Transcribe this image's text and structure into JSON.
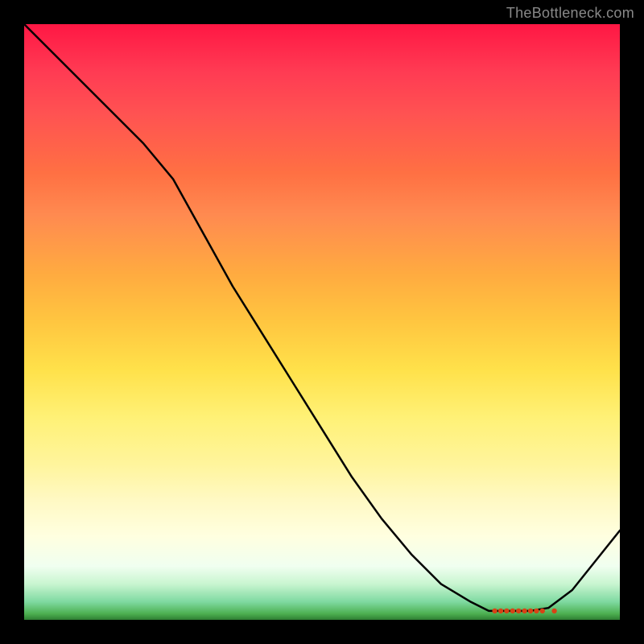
{
  "watermark": "TheBottleneck.com",
  "chart_data": {
    "type": "line",
    "title": "",
    "xlabel": "",
    "ylabel": "",
    "x": [
      0.0,
      0.05,
      0.1,
      0.15,
      0.2,
      0.25,
      0.3,
      0.35,
      0.4,
      0.45,
      0.5,
      0.55,
      0.6,
      0.65,
      0.7,
      0.75,
      0.78,
      0.8,
      0.82,
      0.85,
      0.88,
      0.92,
      0.96,
      1.0
    ],
    "y": [
      1.0,
      0.95,
      0.9,
      0.85,
      0.8,
      0.74,
      0.65,
      0.56,
      0.48,
      0.4,
      0.32,
      0.24,
      0.17,
      0.11,
      0.06,
      0.03,
      0.015,
      0.015,
      0.015,
      0.015,
      0.02,
      0.05,
      0.1,
      0.15
    ],
    "markers": {
      "x": [
        0.79,
        0.8,
        0.81,
        0.82,
        0.83,
        0.84,
        0.85,
        0.86,
        0.87,
        0.89
      ],
      "y": [
        0.015,
        0.015,
        0.015,
        0.015,
        0.015,
        0.015,
        0.015,
        0.015,
        0.015,
        0.015
      ],
      "color": "#d84315"
    },
    "xlim": [
      0,
      1
    ],
    "ylim": [
      0,
      1
    ],
    "grid": false,
    "background_gradient": {
      "type": "vertical",
      "stops": [
        {
          "pos": 0.0,
          "color": "#ff1744"
        },
        {
          "pos": 0.5,
          "color": "#ffc640"
        },
        {
          "pos": 0.85,
          "color": "#fff9c4"
        },
        {
          "pos": 1.0,
          "color": "#2e7d32"
        }
      ]
    }
  }
}
